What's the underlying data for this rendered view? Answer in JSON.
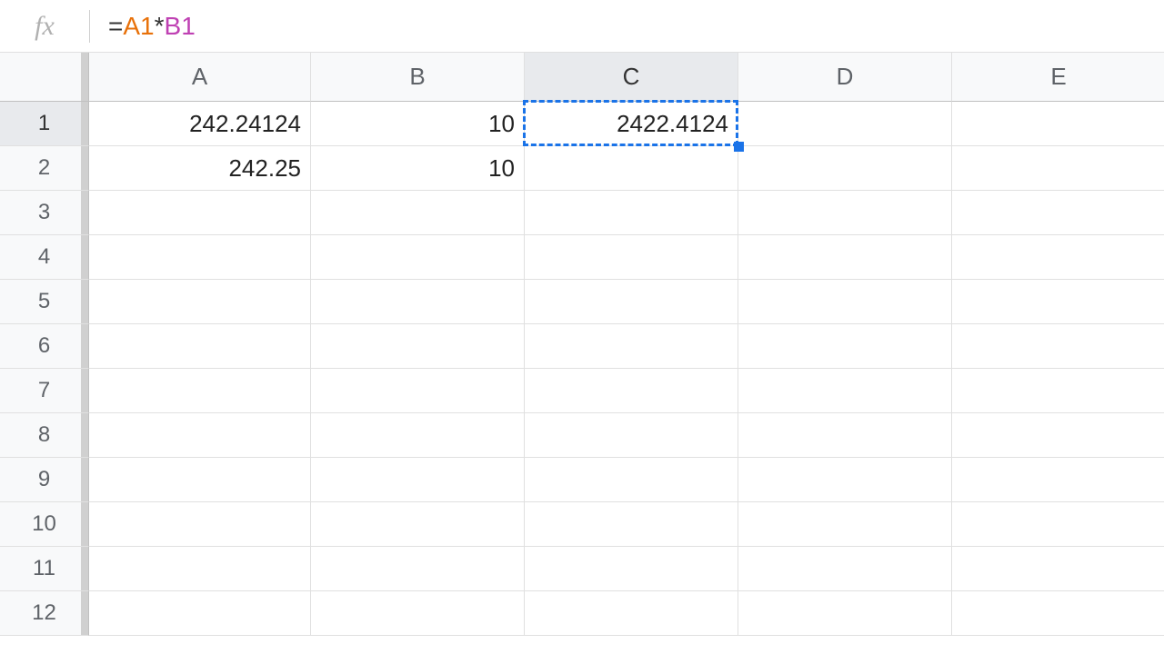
{
  "formula": {
    "prefix": "=",
    "ref1": "A1",
    "op": "*",
    "ref2": "B1"
  },
  "columns": [
    "A",
    "B",
    "C",
    "D",
    "E"
  ],
  "rows": [
    "1",
    "2",
    "3",
    "4",
    "5",
    "6",
    "7",
    "8",
    "9",
    "10",
    "11",
    "12"
  ],
  "activeColumn": "C",
  "activeRow": "1",
  "cells": {
    "A1": "242.24124",
    "B1": "10",
    "C1": "2422.4124",
    "A2": "242.25",
    "B2": "10"
  },
  "selectedCell": "C1"
}
